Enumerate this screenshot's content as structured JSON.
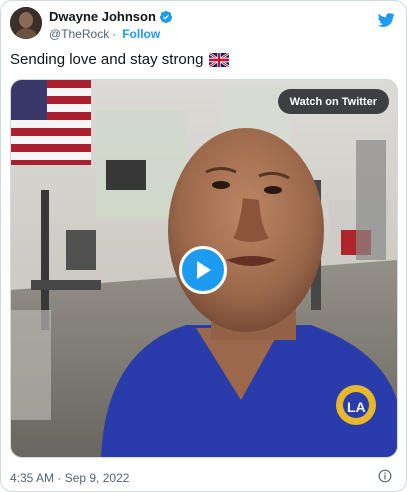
{
  "author": {
    "display_name": "Dwayne Johnson",
    "handle": "@TheRock",
    "separator": "·",
    "follow_label": "Follow",
    "verified": true
  },
  "tweet": {
    "text": "Sending love and stay strong",
    "emoji": "uk-flag"
  },
  "media": {
    "watch_label": "Watch on Twitter",
    "play_icon": "play-icon"
  },
  "footer": {
    "timestamp": "4:35 AM · Sep 9, 2022",
    "info_icon": "info-icon"
  },
  "colors": {
    "accent": "#1d9bf0",
    "text": "#0f1419",
    "secondary": "#536471",
    "border": "#cfd9de"
  }
}
